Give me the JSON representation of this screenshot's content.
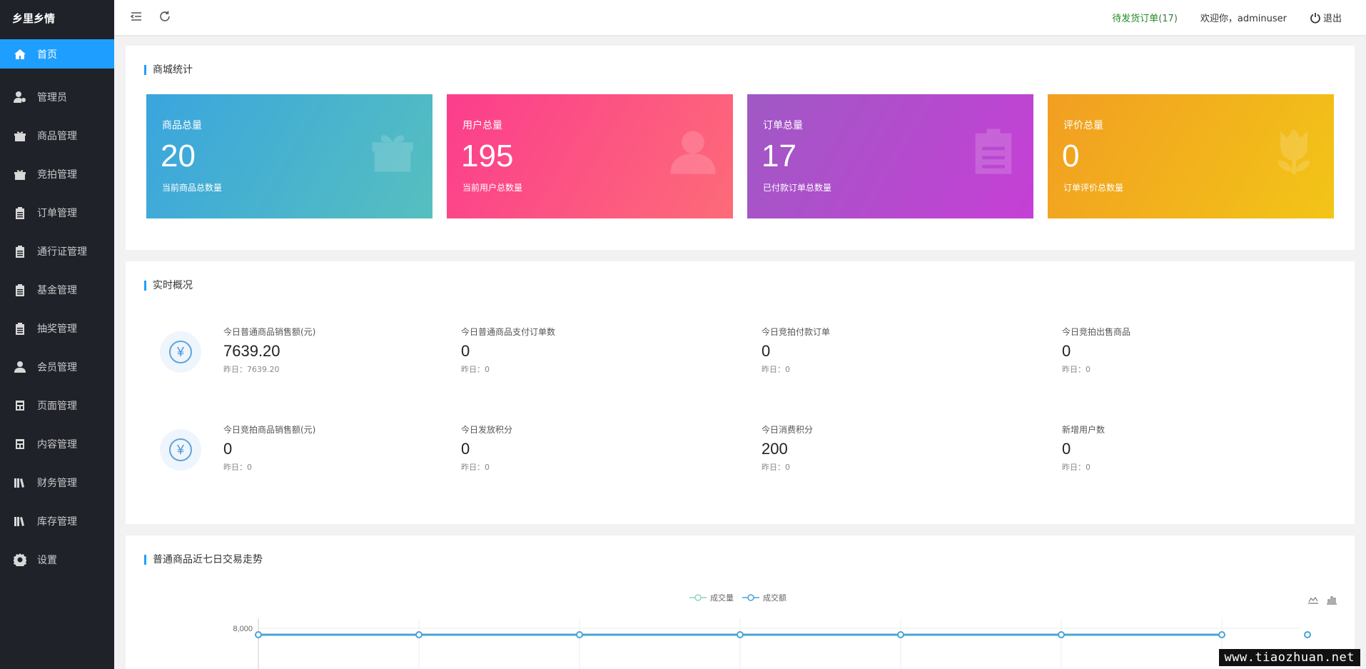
{
  "app": {
    "logo": "乡里乡情"
  },
  "sidebar": {
    "items": [
      {
        "label": "首页",
        "icon": "home-icon",
        "active": true
      },
      {
        "label": "管理员",
        "icon": "user-gear-icon"
      },
      {
        "label": "商品管理",
        "icon": "gift-icon"
      },
      {
        "label": "竞拍管理",
        "icon": "gift-icon"
      },
      {
        "label": "订单管理",
        "icon": "clipboard-icon"
      },
      {
        "label": "通行证管理",
        "icon": "clipboard-icon"
      },
      {
        "label": "基金管理",
        "icon": "clipboard-icon"
      },
      {
        "label": "抽奖管理",
        "icon": "clipboard-icon"
      },
      {
        "label": "会员管理",
        "icon": "user-icon"
      },
      {
        "label": "页面管理",
        "icon": "layout-icon"
      },
      {
        "label": "内容管理",
        "icon": "layout-icon"
      },
      {
        "label": "财务管理",
        "icon": "books-icon"
      },
      {
        "label": "库存管理",
        "icon": "books-icon"
      },
      {
        "label": "设置",
        "icon": "gear-icon"
      }
    ]
  },
  "header": {
    "pending_label": "待发货订单",
    "pending_count": "(17)",
    "welcome": "欢迎你，adminuser",
    "logout": "退出"
  },
  "mall_stats": {
    "title": "商城统计",
    "cards": [
      {
        "label": "商品总量",
        "value": "20",
        "sub": "当前商品总数量",
        "icon": "gift-icon"
      },
      {
        "label": "用户总量",
        "value": "195",
        "sub": "当前用户总数量",
        "icon": "user-icon"
      },
      {
        "label": "订单总量",
        "value": "17",
        "sub": "已付款订单总数量",
        "icon": "clipboard-icon"
      },
      {
        "label": "评价总量",
        "value": "0",
        "sub": "订单评价总数量",
        "icon": "tulip-icon"
      }
    ]
  },
  "realtime": {
    "title": "实时概况",
    "yen_symbol": "¥",
    "rows": [
      [
        {
          "label": "今日普通商品销售额(元)",
          "value": "7639.20",
          "prev": "昨日：7639.20"
        },
        {
          "label": "今日普通商品支付订单数",
          "value": "0",
          "prev": "昨日：0"
        },
        {
          "label": "今日竞拍付款订单",
          "value": "0",
          "prev": "昨日：0"
        },
        {
          "label": "今日竞拍出售商品",
          "value": "0",
          "prev": "昨日：0"
        }
      ],
      [
        {
          "label": "今日竞拍商品销售额(元)",
          "value": "0",
          "prev": "昨日：0"
        },
        {
          "label": "今日发放积分",
          "value": "0",
          "prev": "昨日：0"
        },
        {
          "label": "今日消费积分",
          "value": "200",
          "prev": "昨日：0"
        },
        {
          "label": "新增用户数",
          "value": "0",
          "prev": "昨日：0"
        }
      ]
    ]
  },
  "trend": {
    "title": "普通商品近七日交易走势",
    "legend": [
      "成交量",
      "成交额"
    ]
  },
  "chart_data": {
    "type": "line",
    "series": [
      {
        "name": "成交量",
        "color": "#8fd3c4"
      },
      {
        "name": "成交额",
        "color": "#4aa3d6",
        "values": [
          7639.2,
          7639.2,
          7639.2,
          7639.2,
          7639.2,
          7639.2,
          7639.2
        ]
      }
    ],
    "y_tick_labels": [
      "8,000"
    ],
    "ylim": [
      0,
      8000
    ]
  },
  "watermark": "www.tiaozhuan.net"
}
